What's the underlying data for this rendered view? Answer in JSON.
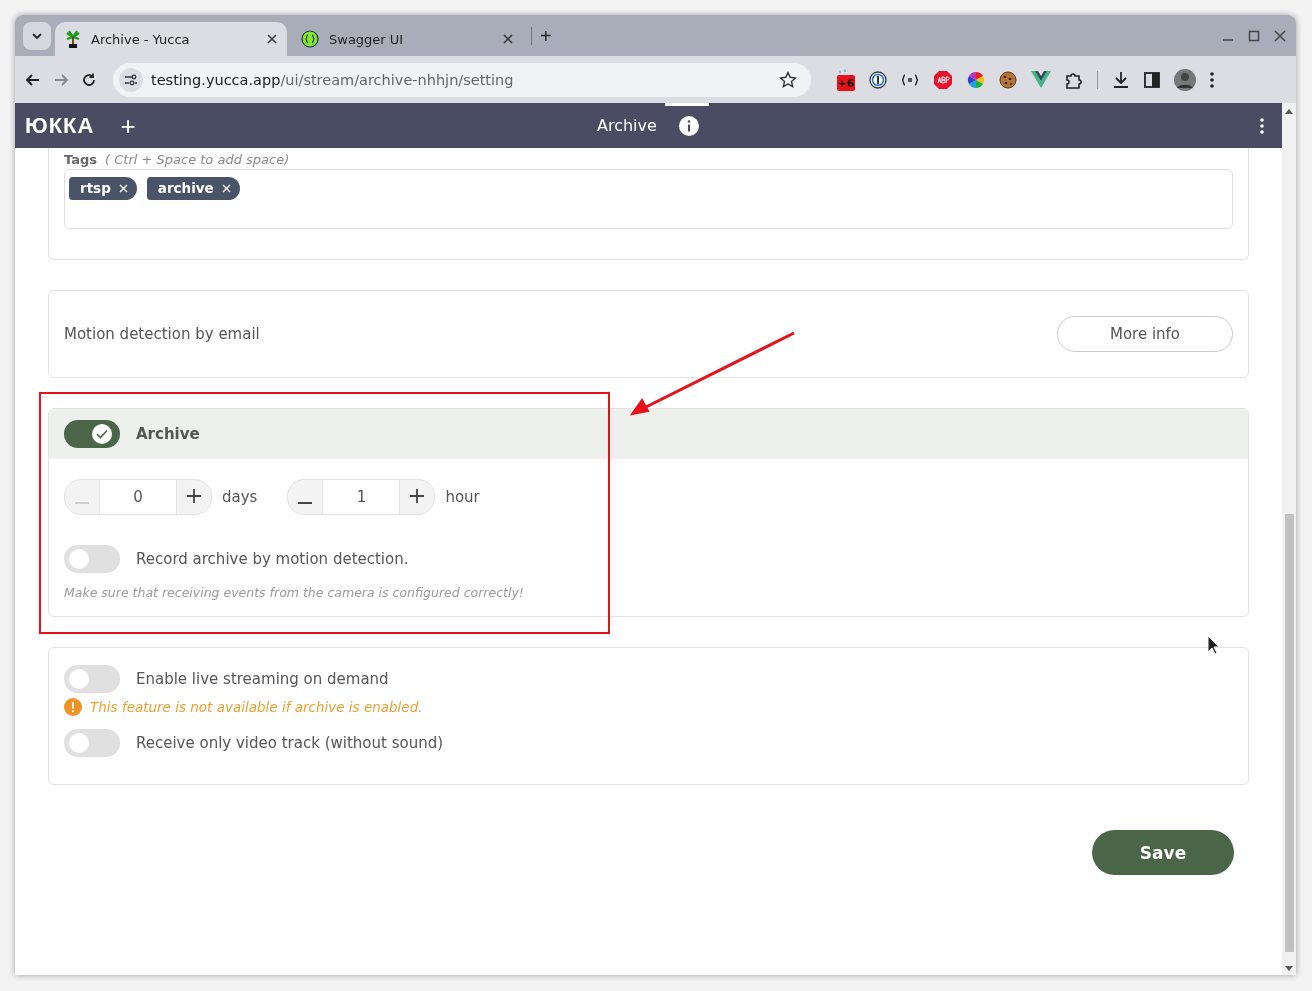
{
  "browser": {
    "tabs": [
      {
        "title": "Archive - Yucca",
        "selected": true,
        "kind": "palm"
      },
      {
        "title": "Swagger UI",
        "selected": false,
        "kind": "swagger"
      }
    ],
    "new_tab": "+",
    "url_host": "testing.yucca.app",
    "url_path": "/ui/stream/archive-nhhjn/setting",
    "extension_badge": "+6"
  },
  "header": {
    "brand": "ЮККА",
    "add": "+",
    "title": "Archive"
  },
  "tags": {
    "label": "Tags",
    "hint": "( Ctrl + Space  to add space)",
    "items": [
      "rtsp",
      "archive"
    ]
  },
  "motion_email": {
    "label": "Motion detection by email",
    "button": "More info"
  },
  "archive": {
    "label": "Archive",
    "on": true,
    "steppers": [
      {
        "value": "0",
        "unit": "days",
        "minus_disabled": true
      },
      {
        "value": "1",
        "unit": "hour",
        "minus_disabled": false
      }
    ],
    "motion": {
      "label": "Record archive by motion detection.",
      "on": false
    },
    "hint": "Make sure that receiving events from the camera is configured correctly!"
  },
  "streaming": [
    {
      "label": "Enable live streaming on demand",
      "on": false,
      "warning": "This feature is not available if archive is enabled."
    },
    {
      "label": "Receive only video track (without sound)",
      "on": false
    }
  ],
  "save": "Save"
}
